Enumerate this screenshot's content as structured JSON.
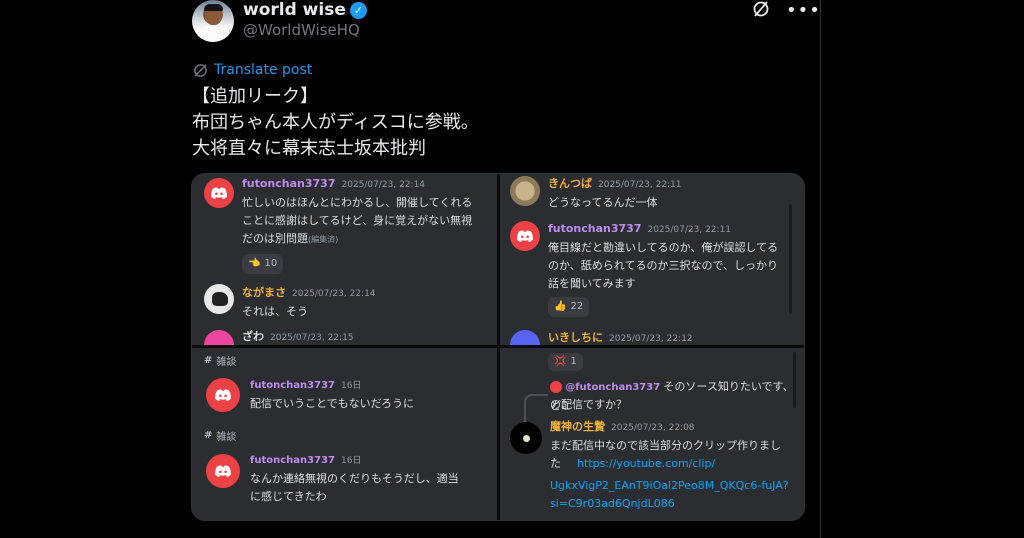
{
  "author": {
    "name": "world wise",
    "handle": "@WorldWiseHQ"
  },
  "translate_label": "Translate post",
  "tweet_lines": [
    "【追加リーク】",
    "布団ちゃん本人がディスコに参戦。",
    "大将直々に幕末志士坂本批判"
  ],
  "icons": {
    "grok": "grok-icon",
    "more": "more-icon",
    "translate": "translate-icon",
    "verified": "verified-badge-icon"
  },
  "colors": {
    "verified": "#1d9bf0",
    "link": "#00a8fc",
    "discord_red": "#ed4245",
    "futon_name": "#c08cf0",
    "yellow_name": "#f0b232"
  },
  "panel1": {
    "m1": {
      "user": "futonchan3737",
      "time": "2025/07/23, 22:14",
      "lines": [
        "忙しいのはほんとにわかるし、開催してくれる",
        "ことに感謝はしてるけど、身に覚えがない無視",
        "だのは別問題"
      ],
      "edited": "(編集済)",
      "reaction_count": "10"
    },
    "m2": {
      "user": "ながまさ",
      "time": "2025/07/23, 22:14",
      "text": "それは、そう"
    },
    "m3": {
      "user": "ざわ",
      "time": "2025/07/23, 22:15"
    }
  },
  "panel2": {
    "m1": {
      "user": "きんつば",
      "time": "2025/07/23, 22:11",
      "text": "どうなってるんだ一体"
    },
    "m2": {
      "user": "futonchan3737",
      "time": "2025/07/23, 22:11",
      "lines": [
        "俺目線だと勘違いしてるのか、俺が誤認してる",
        "のか、舐められてるのか三択なので、しっかり",
        "話を聞いてみます"
      ],
      "reaction_count": "22"
    },
    "m3": {
      "user": "いきしちに",
      "time": "2025/07/23, 22:12"
    }
  },
  "panel3": {
    "channel1": "雑談",
    "m1": {
      "user": "futonchan3737",
      "time": "16日",
      "text": "配信でいうことでもないだろうに"
    },
    "channel2": "雑談",
    "m2": {
      "user": "futonchan3737",
      "time": "16日",
      "lines": [
        "なんか連絡無視のくだりもそうだし、適当",
        "に感じてきたわ"
      ]
    }
  },
  "panel4": {
    "top_reaction_count": "1",
    "reply": {
      "user": "@futonchan3737",
      "text": "そのソース知りたいです、どこ",
      "text2": "の配信ですか？"
    },
    "m1": {
      "user": "魔神の生贄",
      "time": "2025/07/23, 22:08",
      "lines": [
        "まだ配信中なので該当部分のクリップ作りまし",
        "た"
      ],
      "link1": "https://youtube.com/clip/",
      "link2": "UgkxVigP2_EAnT9iOal2Peo8M_QKQc6-fuJA?",
      "link3": "si=C9r03ad6QnjdL086"
    }
  }
}
